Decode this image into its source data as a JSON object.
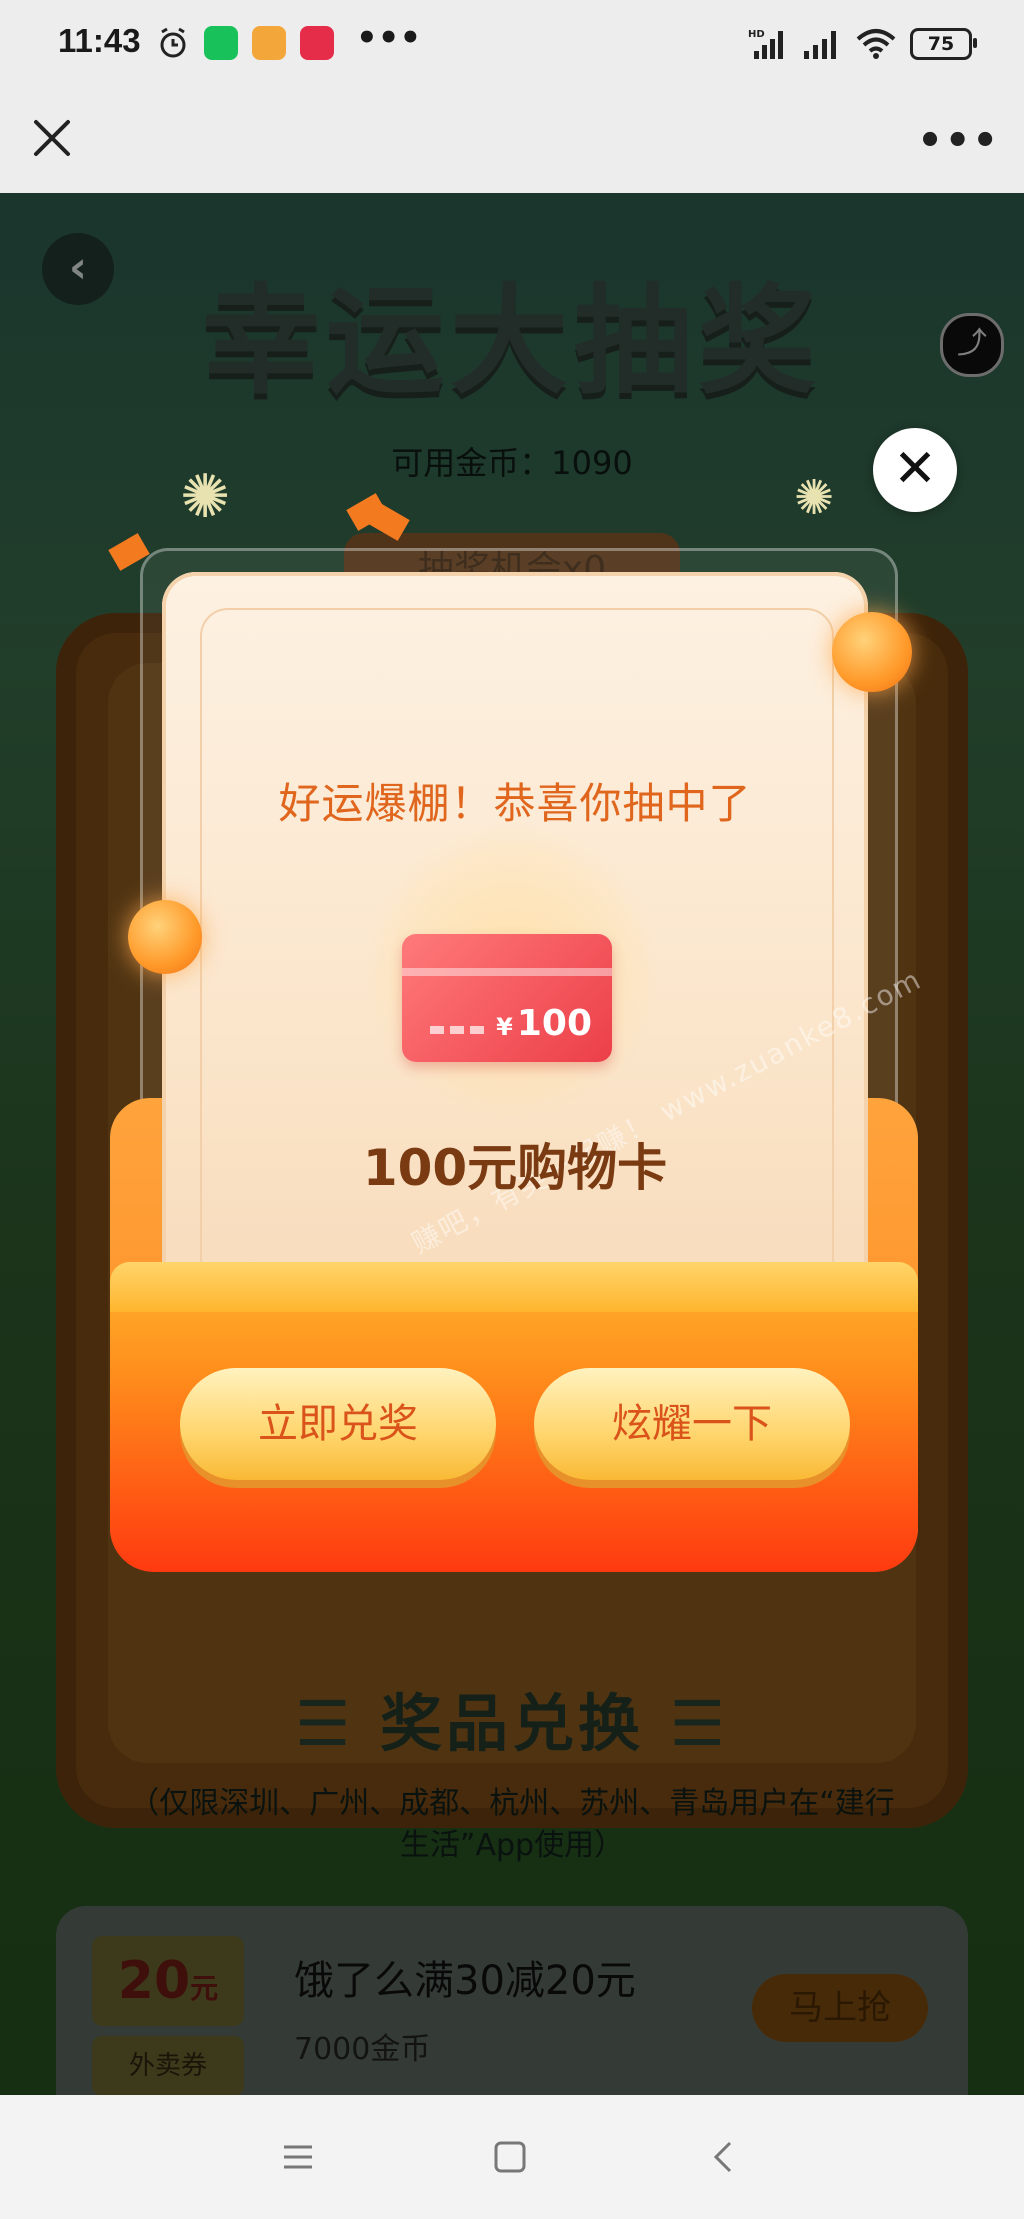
{
  "status_bar": {
    "time": "11:43",
    "network": "HD",
    "battery": "75",
    "more": "•••"
  },
  "webview": {
    "close_icon": "close-icon",
    "more_label": "•••"
  },
  "page": {
    "back_glyph": "‹",
    "title": "幸运大抽奖",
    "coins_label": "可用金币：1090",
    "chances_label": "抽奖机会x0",
    "exchange_title": "奖品兑换",
    "exchange_note": "（仅限深圳、广州、成都、杭州、苏州、青岛用户在“建行生活”App使用）",
    "prize_item": {
      "amount": "20",
      "unit": "元",
      "type": "外卖券",
      "name": "饿了么满30减20元",
      "cost": "7000金币",
      "button": "马上抢"
    }
  },
  "modal": {
    "close_glyph": "✕",
    "message": "好运爆棚！恭喜你抽中了",
    "card_currency": "¥",
    "card_amount": "100",
    "prize_name": "100元购物卡",
    "redeem_button": "立即兑奖",
    "share_button": "炫耀一下",
    "watermark": "赚吧，有奖一起赚！ www.zuanke8.com"
  },
  "colors": {
    "accent_orange": "#e0661e",
    "button_text": "#d9531a",
    "card_red": "#ec3f49"
  }
}
